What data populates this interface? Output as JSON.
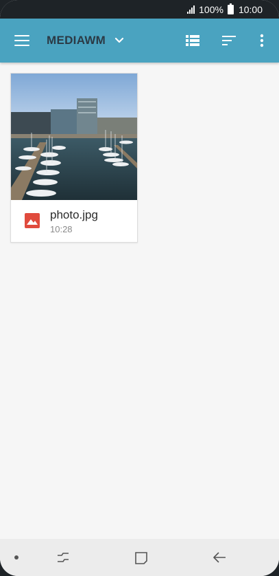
{
  "status_bar": {
    "battery": "100%",
    "time": "10:00"
  },
  "app_bar": {
    "title": "MEDIAWM",
    "color": "#4aa3c0"
  },
  "files": [
    {
      "name": "photo.jpg",
      "time": "10:28",
      "type_icon": "image-icon",
      "type_color": "#e04b3d"
    }
  ],
  "icons": {
    "menu": "hamburger-menu-icon",
    "dropdown": "chevron-down-icon",
    "view": "list-view-icon",
    "sort": "sort-icon",
    "more": "more-vertical-icon",
    "nav_recents": "recents-icon",
    "nav_home": "home-icon",
    "nav_back": "back-icon"
  }
}
